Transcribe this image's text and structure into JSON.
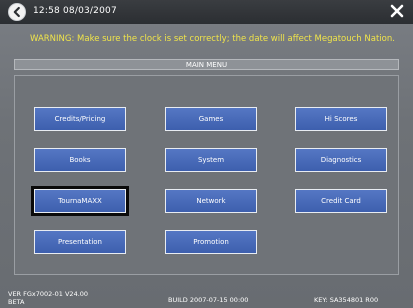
{
  "topbar": {
    "clock": "12:58  08/03/2007"
  },
  "warning": "WARNING: Make sure the clock is set correctly; the date will affect Megatouch Nation.",
  "menu_title": "MAIN MENU",
  "buttons": [
    {
      "label": "Credits/Pricing",
      "name": "credits-pricing-button"
    },
    {
      "label": "Games",
      "name": "games-button"
    },
    {
      "label": "Hi Scores",
      "name": "hi-scores-button"
    },
    {
      "label": "Books",
      "name": "books-button"
    },
    {
      "label": "System",
      "name": "system-button"
    },
    {
      "label": "Diagnostics",
      "name": "diagnostics-button"
    },
    {
      "label": "TournaMAXX",
      "name": "tournamaxx-button",
      "selected": true
    },
    {
      "label": "Network",
      "name": "network-button"
    },
    {
      "label": "Credit Card",
      "name": "credit-card-button"
    },
    {
      "label": "Presentation",
      "name": "presentation-button"
    },
    {
      "label": "Promotion",
      "name": "promotion-button"
    }
  ],
  "footer": {
    "version": "VER  FGx7002-01 V24.00",
    "beta": "BETA",
    "build": "BUILD  2007-07-15  00:00",
    "key": "KEY:  SA354801 R00"
  },
  "colors": {
    "warning": "#f0e44a",
    "button_fill": "#3d5fae",
    "background": "#6f7378"
  },
  "icons": {
    "back": "back-arrow-icon",
    "close": "close-icon"
  }
}
